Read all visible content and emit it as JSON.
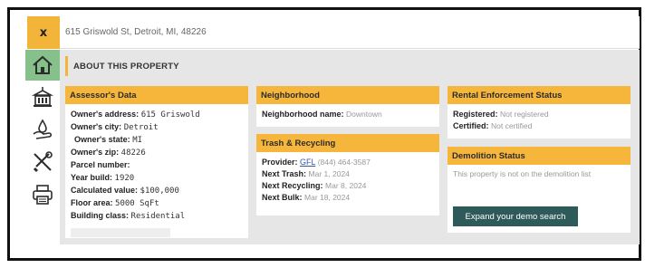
{
  "header": {
    "close_label": "x",
    "address": "615 Griswold St, Detroit, MI, 48226"
  },
  "nav": [
    {
      "icon": "home-icon"
    },
    {
      "icon": "building-icon"
    },
    {
      "icon": "hand-drop-icon"
    },
    {
      "icon": "tools-icon"
    },
    {
      "icon": "printer-icon"
    }
  ],
  "page": {
    "title": "ABOUT THIS PROPERTY"
  },
  "assessor": {
    "title": "Assessor's Data",
    "fields": [
      {
        "label": "Owner's address:",
        "value": "615 Griswold",
        "mono": true
      },
      {
        "label": "Owner's city:",
        "value": "Detroit",
        "mono": true
      },
      {
        "label": "Owner's state:",
        "value": "MI",
        "mono": true
      },
      {
        "label": "Owner's zip:",
        "value": "48226",
        "mono": true
      },
      {
        "label": "Parcel number:",
        "value": "",
        "mono": true
      },
      {
        "label": "Year build:",
        "value": "1920",
        "mono": true
      },
      {
        "label": "Calculated value:",
        "value": "$100,000",
        "mono": true
      },
      {
        "label": "Floor area:",
        "value": "5000 SqFt",
        "mono": false
      },
      {
        "label": "Building class:",
        "value": "Residential",
        "mono": true
      }
    ]
  },
  "neighborhood": {
    "title": "Neighborhood",
    "label": "Neighborhood name:",
    "value": "Downtown"
  },
  "trash": {
    "title": "Trash & Recycling",
    "provider_label": "Provider:",
    "provider_name": "GFL",
    "provider_phone": "(844) 464-3587",
    "fields": [
      {
        "label": "Next Trash:",
        "value": "Mar 1, 2024"
      },
      {
        "label": "Next Recycling:",
        "value": "Mar 8, 2024"
      },
      {
        "label": "Next Bulk:",
        "value": "Mar 18, 2024"
      }
    ]
  },
  "rental": {
    "title": "Rental Enforcement Status",
    "fields": [
      {
        "label": "Registered:",
        "value": "Not registered"
      },
      {
        "label": "Certified:",
        "value": "Not certified"
      }
    ]
  },
  "demolition": {
    "title": "Demolition Status",
    "text": "This property is not on the demolition list",
    "button_label": "Expand your demo search"
  },
  "colors": {
    "accent": "#f5b63b",
    "nav_active": "#86c08a",
    "button": "#2e5a5a"
  }
}
